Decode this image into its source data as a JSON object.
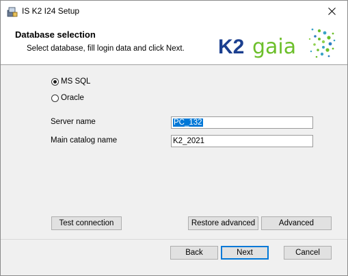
{
  "window": {
    "title": "IS K2 I24 Setup"
  },
  "banner": {
    "title": "Database selection",
    "subtitle": "Select database, fill login data and click Next.",
    "logo_text": "K2 gaia"
  },
  "database": {
    "options": [
      {
        "label": "MS SQL",
        "selected": true
      },
      {
        "label": "Oracle",
        "selected": false
      }
    ]
  },
  "fields": {
    "server_label": "Server name",
    "server_value": "PC_132",
    "catalog_label": "Main catalog name",
    "catalog_value": "K2_2021"
  },
  "buttons": {
    "test_connection": "Test connection",
    "restore_advanced": "Restore advanced",
    "advanced": "Advanced",
    "back": "Back",
    "next": "Next",
    "cancel": "Cancel"
  },
  "colors": {
    "accent": "#0078d7",
    "logo_blue": "#1b3f8f",
    "logo_green": "#6cbf2a"
  }
}
